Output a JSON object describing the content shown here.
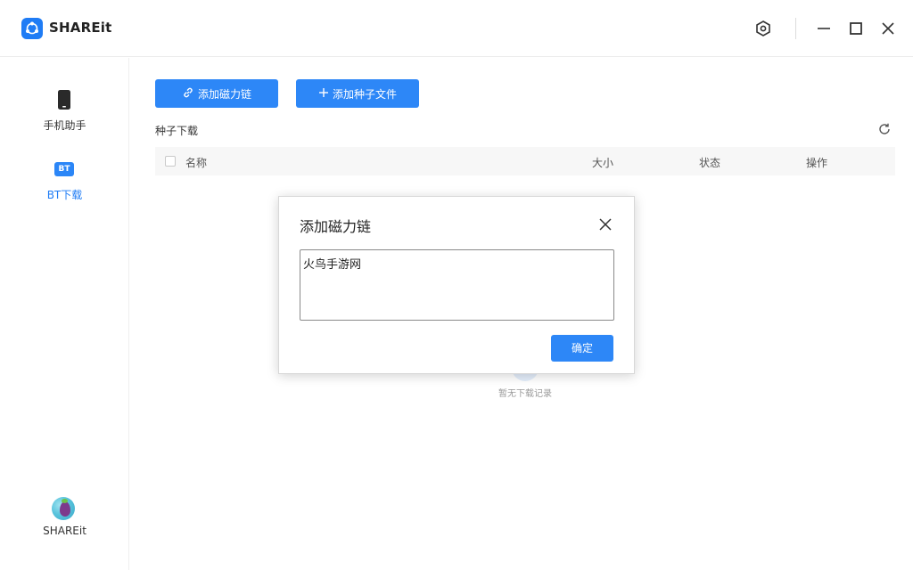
{
  "app": {
    "name": "SHAREit"
  },
  "titlebar": {
    "icons": [
      "settings-icon",
      "minimize-icon",
      "maximize-icon",
      "close-icon"
    ]
  },
  "sidebar": {
    "items": [
      {
        "label": "手机助手",
        "icon": "phone-icon",
        "active": false
      },
      {
        "label": "BT下载",
        "icon": "bt-icon",
        "badge": "BT",
        "active": true
      }
    ],
    "user": {
      "name": "SHAREit",
      "icon": "avatar-icon"
    }
  },
  "toolbar": {
    "add_magnet_label": "添加磁力链",
    "add_torrent_label": "添加种子文件"
  },
  "main": {
    "section_title": "种子下载",
    "table": {
      "columns": [
        "名称",
        "大小",
        "状态",
        "操作"
      ]
    },
    "empty_text": "暂无下载记录"
  },
  "dialog": {
    "title": "添加磁力链",
    "input_value": "火鸟手游网",
    "confirm_label": "确定"
  },
  "colors": {
    "accent": "#2d87f7",
    "brand": "#1f7cf5"
  }
}
